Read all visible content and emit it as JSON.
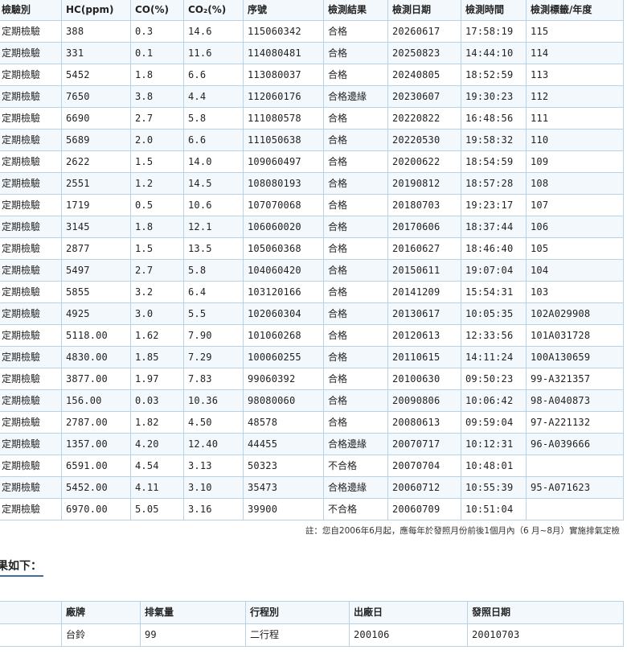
{
  "inspection_table": {
    "headers": [
      "檢驗別",
      "HC(ppm)",
      "CO(%)",
      "CO₂(%)",
      "序號",
      "檢測結果",
      "檢測日期",
      "檢測時間",
      "檢測標籤/年度"
    ],
    "rows": [
      [
        "定期檢驗",
        "388",
        "0.3",
        "14.6",
        "115060342",
        "合格",
        "20260617",
        "17:58:19",
        "115"
      ],
      [
        "定期檢驗",
        "331",
        "0.1",
        "11.6",
        "114080481",
        "合格",
        "20250823",
        "14:44:10",
        "114"
      ],
      [
        "定期檢驗",
        "5452",
        "1.8",
        "6.6",
        "113080037",
        "合格",
        "20240805",
        "18:52:59",
        "113"
      ],
      [
        "定期檢驗",
        "7650",
        "3.8",
        "4.4",
        "112060176",
        "合格邊緣",
        "20230607",
        "19:30:23",
        "112"
      ],
      [
        "定期檢驗",
        "6690",
        "2.7",
        "5.8",
        "111080578",
        "合格",
        "20220822",
        "16:48:56",
        "111"
      ],
      [
        "定期檢驗",
        "5689",
        "2.0",
        "6.6",
        "111050638",
        "合格",
        "20220530",
        "19:58:32",
        "110"
      ],
      [
        "定期檢驗",
        "2622",
        "1.5",
        "14.0",
        "109060497",
        "合格",
        "20200622",
        "18:54:59",
        "109"
      ],
      [
        "定期檢驗",
        "2551",
        "1.2",
        "14.5",
        "108080193",
        "合格",
        "20190812",
        "18:57:28",
        "108"
      ],
      [
        "定期檢驗",
        "1719",
        "0.5",
        "10.6",
        "107070068",
        "合格",
        "20180703",
        "19:23:17",
        "107"
      ],
      [
        "定期檢驗",
        "3145",
        "1.8",
        "12.1",
        "106060020",
        "合格",
        "20170606",
        "18:37:44",
        "106"
      ],
      [
        "定期檢驗",
        "2877",
        "1.5",
        "13.5",
        "105060368",
        "合格",
        "20160627",
        "18:46:40",
        "105"
      ],
      [
        "定期檢驗",
        "5497",
        "2.7",
        "5.8",
        "104060420",
        "合格",
        "20150611",
        "19:07:04",
        "104"
      ],
      [
        "定期檢驗",
        "5855",
        "3.2",
        "6.4",
        "103120166",
        "合格",
        "20141209",
        "15:54:31",
        "103"
      ],
      [
        "定期檢驗",
        "4925",
        "3.0",
        "5.5",
        "102060304",
        "合格",
        "20130617",
        "10:05:35",
        "102A029908"
      ],
      [
        "定期檢驗",
        "5118.00",
        "1.62",
        "7.90",
        "101060268",
        "合格",
        "20120613",
        "12:33:56",
        "101A031728"
      ],
      [
        "定期檢驗",
        "4830.00",
        "1.85",
        "7.29",
        "100060255",
        "合格",
        "20110615",
        "14:11:24",
        "100A130659"
      ],
      [
        "定期檢驗",
        "3877.00",
        "1.97",
        "7.83",
        "99060392",
        "合格",
        "20100630",
        "09:50:23",
        "99-A321357"
      ],
      [
        "定期檢驗",
        "156.00",
        "0.03",
        "10.36",
        "98080060",
        "合格",
        "20090806",
        "10:06:42",
        "98-A040873"
      ],
      [
        "定期檢驗",
        "2787.00",
        "1.82",
        "4.50",
        "48578",
        "合格",
        "20080613",
        "09:59:04",
        "97-A221132"
      ],
      [
        "定期檢驗",
        "1357.00",
        "4.20",
        "12.40",
        "44455",
        "合格邊緣",
        "20070717",
        "10:12:31",
        "96-A039666"
      ],
      [
        "定期檢驗",
        "6591.00",
        "4.54",
        "3.13",
        "50323",
        "不合格",
        "20070704",
        "10:48:01",
        ""
      ],
      [
        "定期檢驗",
        "5452.00",
        "4.11",
        "3.10",
        "35473",
        "合格邊緣",
        "20060712",
        "10:55:39",
        "95-A071623"
      ],
      [
        "定期檢驗",
        "6970.00",
        "5.05",
        "3.16",
        "39900",
        "不合格",
        "20060709",
        "10:51:04",
        ""
      ]
    ]
  },
  "note": "註：您自2006年6月起，應每年於發照月份前後1個月內（6 月~8月）實施排氣定檢",
  "section_title": "果如下：",
  "vehicle_table": {
    "headers": [
      "",
      "廠牌",
      "排氣量",
      "行程別",
      "出廠日",
      "發照日期"
    ],
    "row": [
      "",
      "台鈴",
      "99",
      "二行程",
      "200106",
      "20010703"
    ]
  },
  "colors": {
    "border": "#b9d3e6",
    "stripe": "#f3f8fc",
    "underline": "#3a6ea5"
  }
}
